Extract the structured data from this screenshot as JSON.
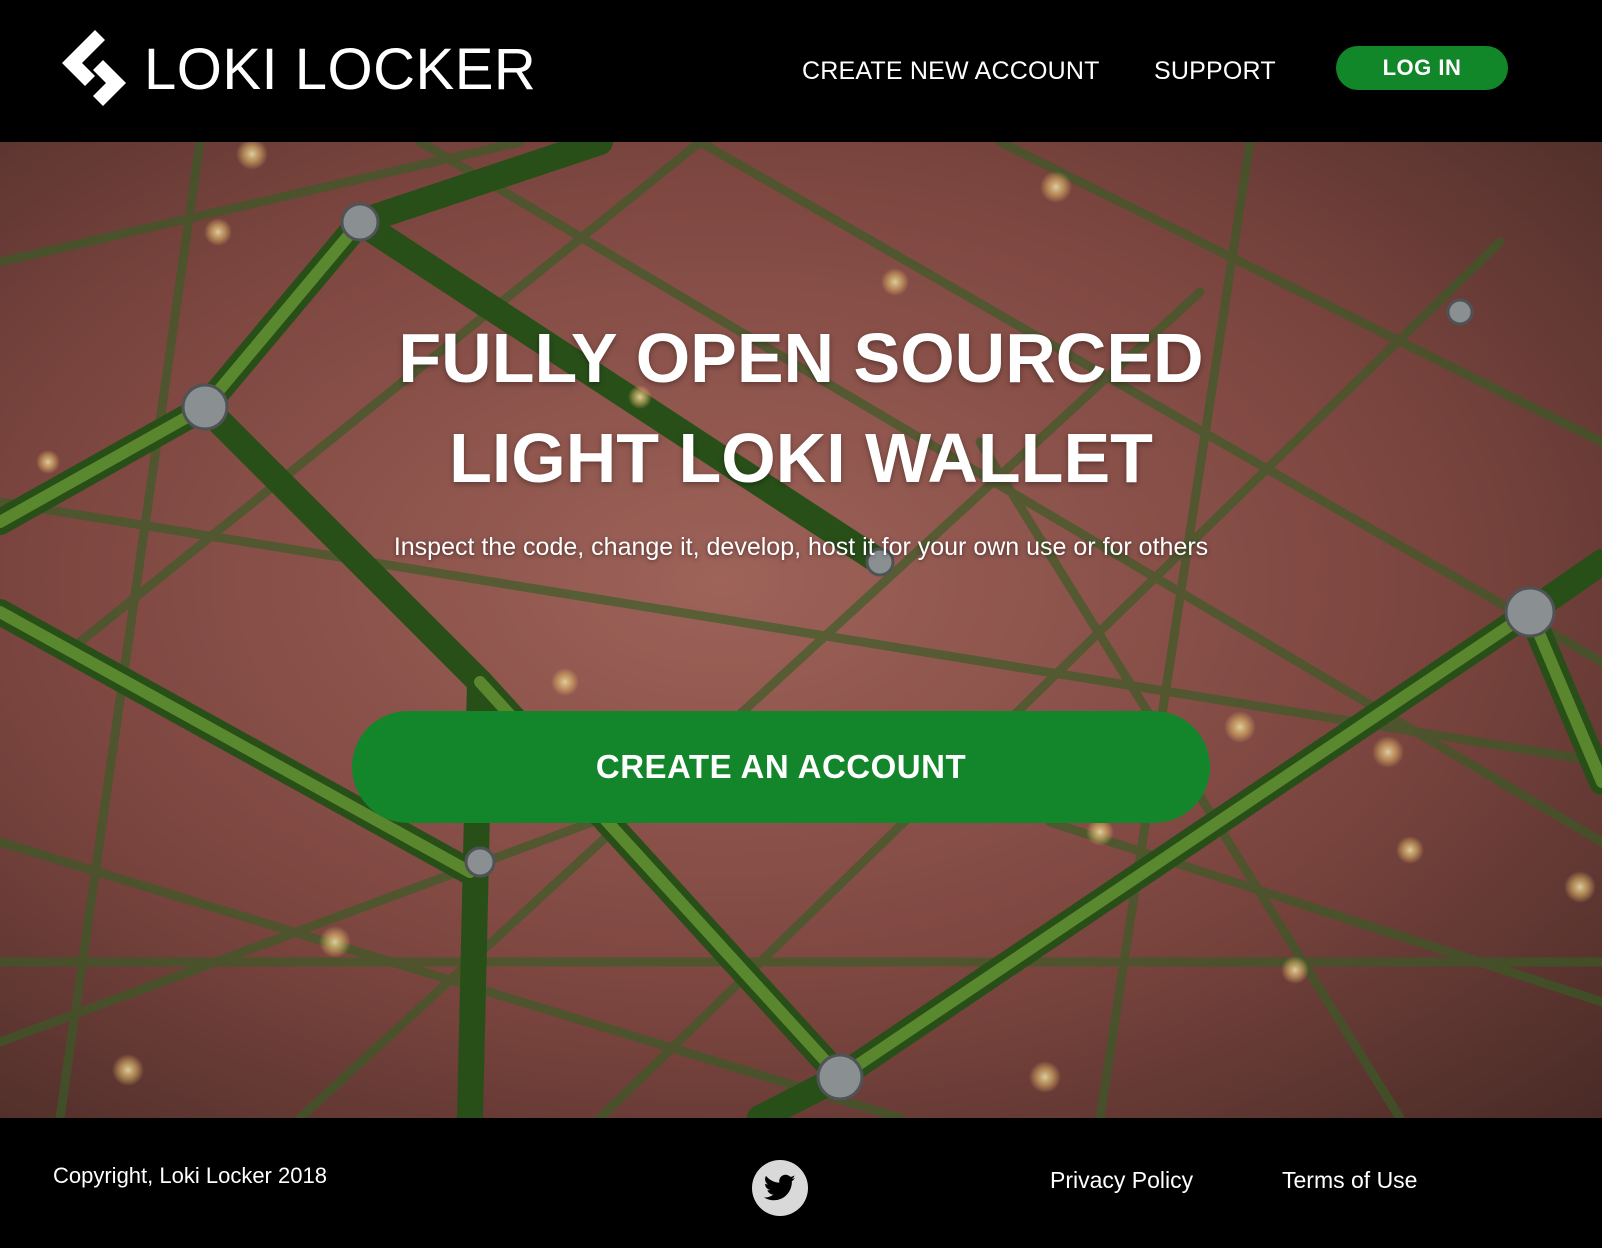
{
  "header": {
    "logo_text": "LOKI LOCKER",
    "nav": {
      "create_account": "CREATE NEW ACCOUNT",
      "support": "SUPPORT",
      "login": "LOG IN"
    }
  },
  "hero": {
    "title_line1": "FULLY OPEN SOURCED",
    "title_line2": "LIGHT LOKI WALLET",
    "subtitle": "Inspect the code, change it, develop, host it for your own use or for others",
    "cta_label": "CREATE AN ACCOUNT"
  },
  "footer": {
    "copyright": "Copyright, Loki Locker 2018",
    "social_icon": "twitter-icon",
    "privacy": "Privacy Policy",
    "terms": "Terms of Use"
  },
  "colors": {
    "accent_green": "#13862b",
    "header_bg": "#000000",
    "hero_bg": "#8e5049",
    "rope_green": "#4d8f24"
  }
}
